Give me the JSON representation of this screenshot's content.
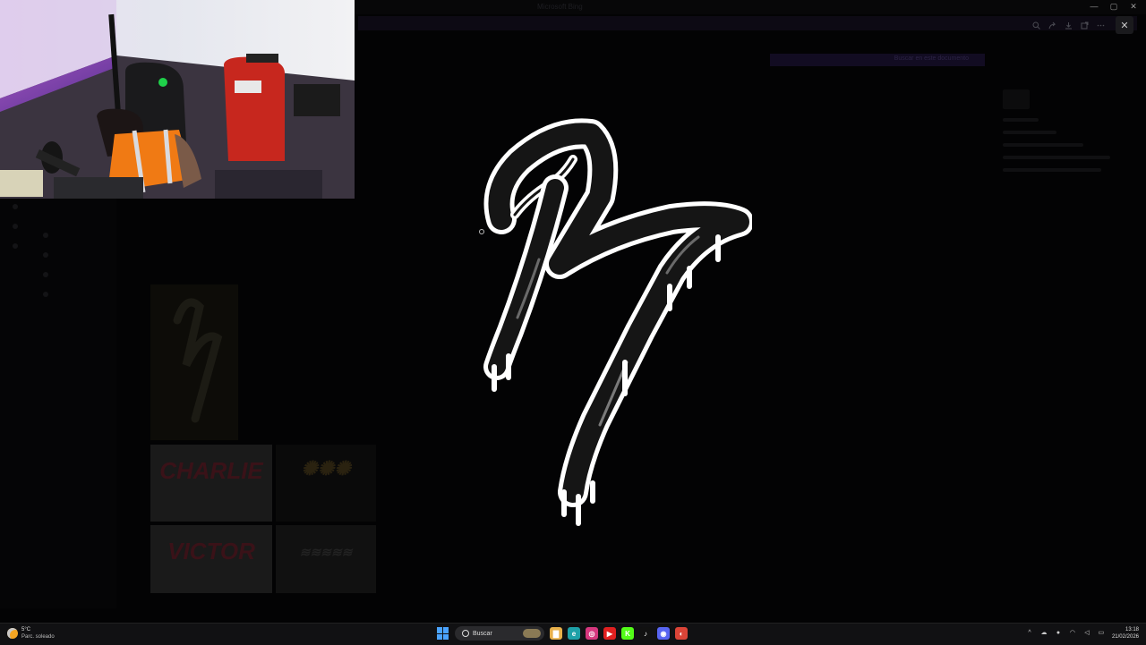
{
  "background_app": {
    "title": "Microsoft Bing",
    "pill_text": "Buscar en este documento"
  },
  "thumbnails": {
    "charlie_label": "CHARLIE",
    "victor_label": "VICTOR"
  },
  "viewer_toolbar": {
    "buttons": [
      "zoom-in-icon",
      "share-icon",
      "download-icon",
      "open-external-icon",
      "more-icon"
    ],
    "close": "✕"
  },
  "window_controls": [
    "—",
    "▢",
    "✕"
  ],
  "taskbar": {
    "weather_temp": "5°C",
    "weather_condition": "Parc. soleado",
    "search_placeholder": "Buscar",
    "apps": [
      {
        "name": "file-explorer-icon",
        "color": "#e8b04a",
        "glyph": "▇"
      },
      {
        "name": "edge-icon",
        "color": "#1ea1a8",
        "glyph": "e"
      },
      {
        "name": "instagram-icon",
        "color": "#d6377e",
        "glyph": "◎"
      },
      {
        "name": "youtube-icon",
        "color": "#e02020",
        "glyph": "▶"
      },
      {
        "name": "kick-icon",
        "color": "#53fc18",
        "glyph": "K"
      },
      {
        "name": "tiktok-icon",
        "color": "#111111",
        "glyph": "♪"
      },
      {
        "name": "discord-icon",
        "color": "#5865f2",
        "glyph": "◉"
      },
      {
        "name": "chrome-icon",
        "color": "#db4437",
        "glyph": "◐"
      }
    ],
    "time": "13:18",
    "date": "21/02/2026"
  },
  "colors": {
    "logo_outline": "#ffffff",
    "logo_fill": "#151515",
    "accent": "#4aa3ff"
  }
}
